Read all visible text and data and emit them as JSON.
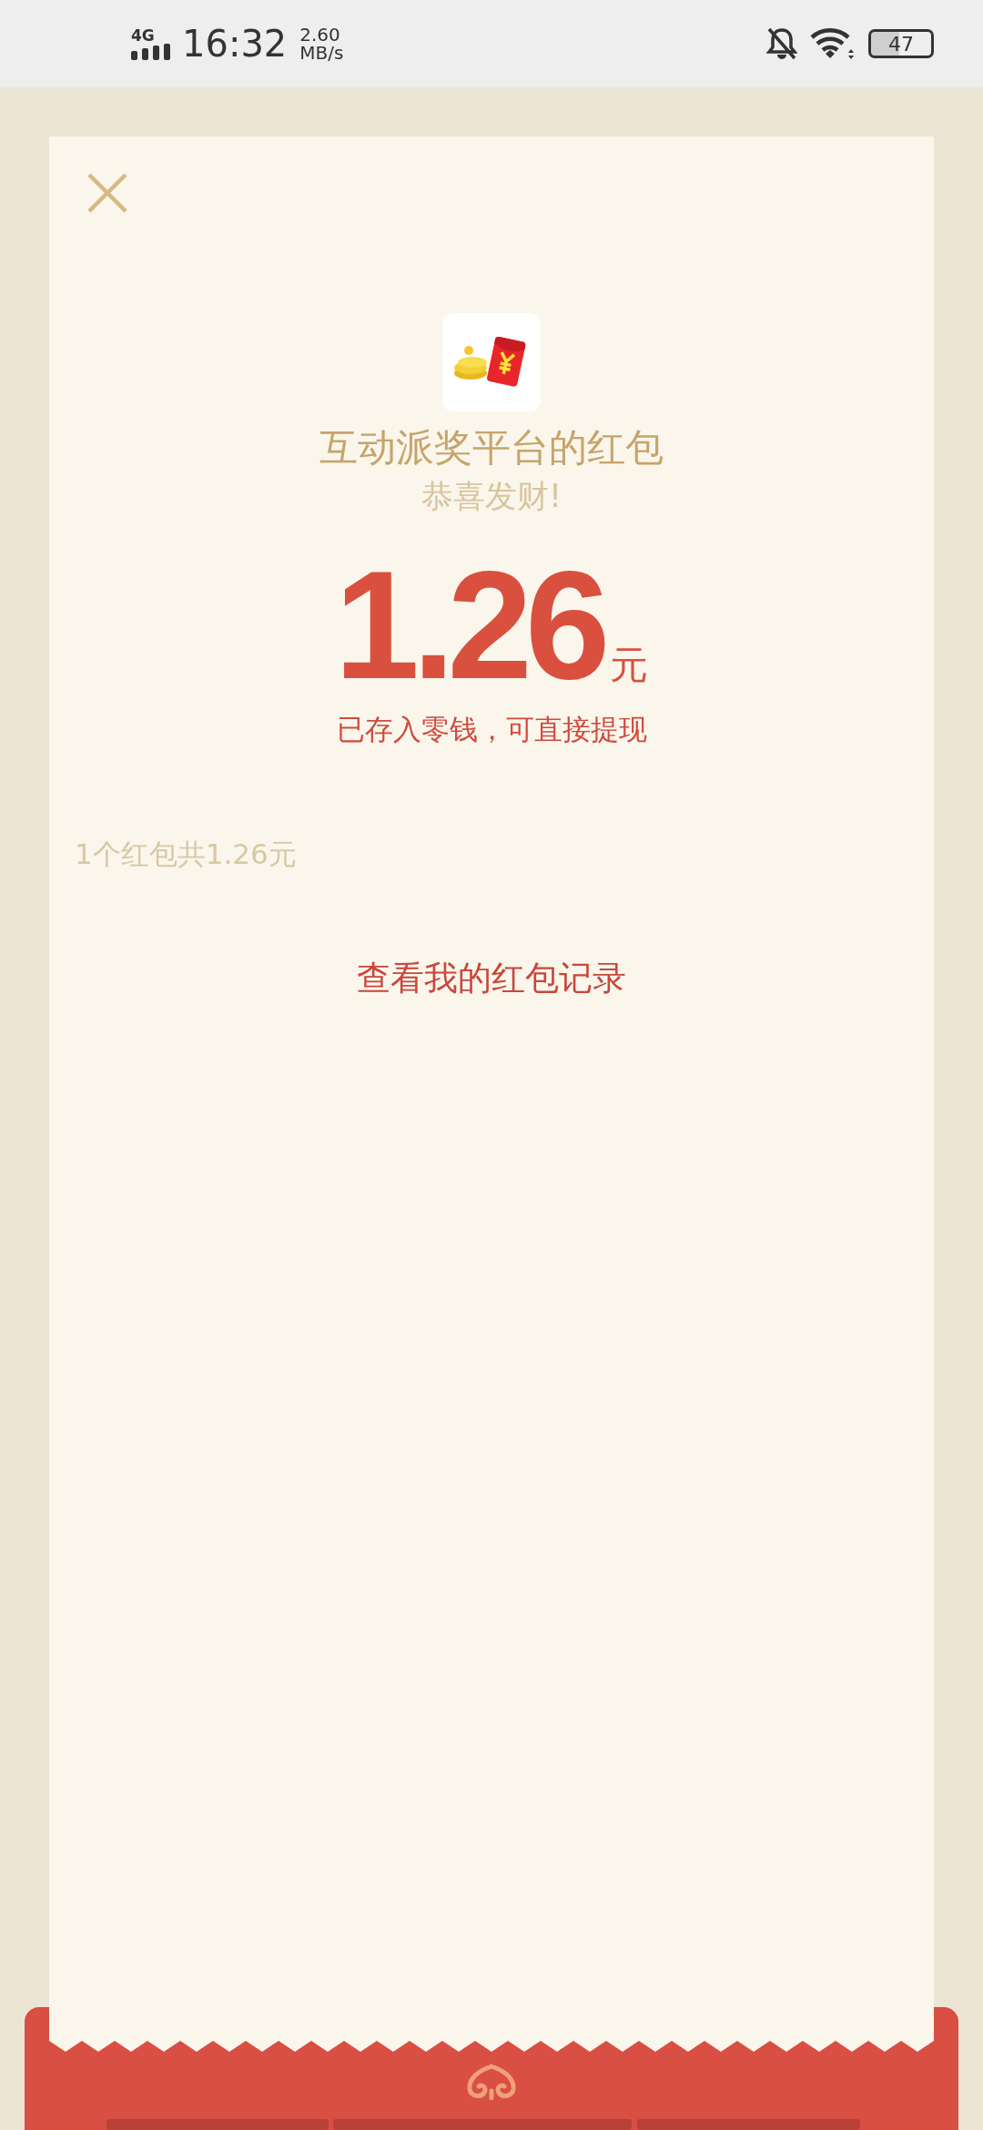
{
  "status_bar": {
    "network": "4G",
    "time": "16:32",
    "speed": "2.60",
    "speed_unit": "MB/s",
    "battery": "47"
  },
  "sender": "互动派奖平台的红包",
  "greeting": "恭喜发财!",
  "amount": "1.26",
  "currency": "元",
  "note": "已存入零钱，可直接提现",
  "summary": "1个红包共1.26元",
  "records_link": "查看我的红包记录"
}
